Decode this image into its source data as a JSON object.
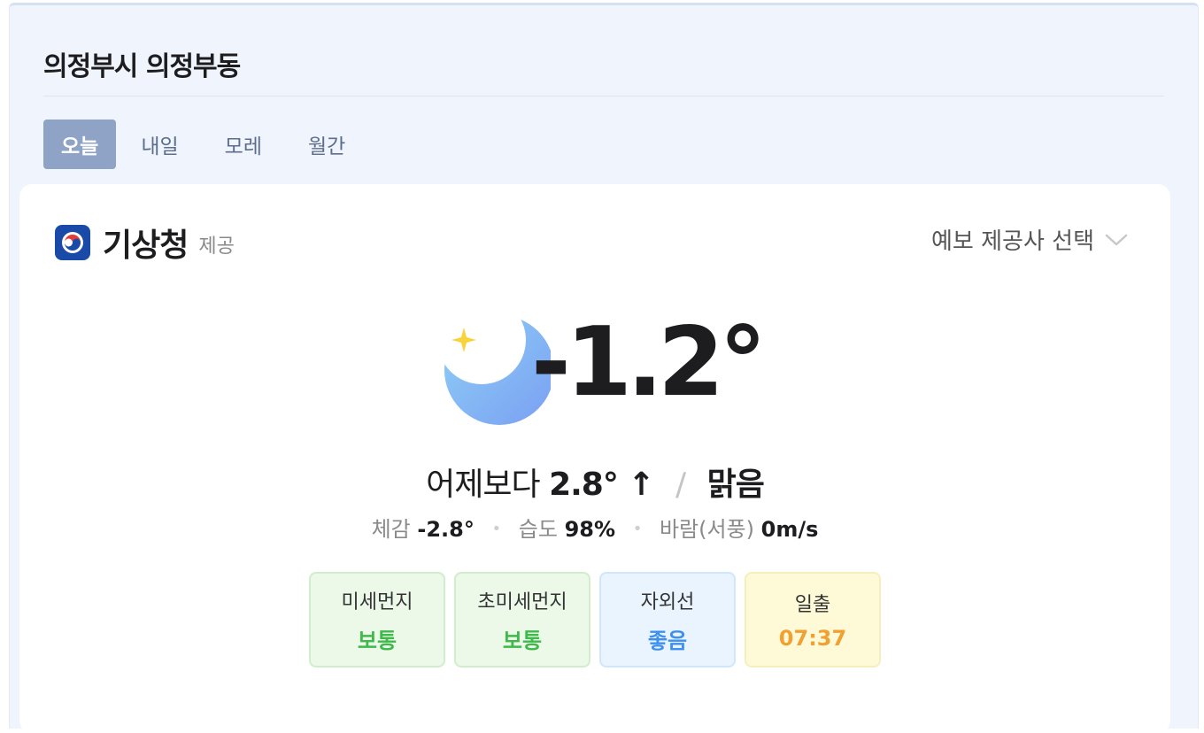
{
  "location": "의정부시 의정부동",
  "tabs": [
    {
      "label": "오늘",
      "active": true
    },
    {
      "label": "내일",
      "active": false
    },
    {
      "label": "모레",
      "active": false
    },
    {
      "label": "월간",
      "active": false
    }
  ],
  "provider": {
    "name": "기상청",
    "suffix": "제공"
  },
  "select_label": "예보 제공사 선택",
  "icons": {
    "logo": "kma-logo-icon",
    "weather": "crescent-moon-star-icon",
    "dropdown": "chevron-down-icon"
  },
  "current": {
    "temperature": "-1.2°",
    "compare_prefix": "어제보다",
    "compare_value": "2.8° ↑",
    "separator": "/",
    "condition": "맑음"
  },
  "details": [
    {
      "label": "체감",
      "value": "-2.8°"
    },
    {
      "label": "습도",
      "value": "98%"
    },
    {
      "label": "바람(서풍)",
      "value": "0m/s"
    }
  ],
  "detail_dot": "•",
  "tiles": [
    {
      "label": "미세먼지",
      "value": "보통",
      "tone": "green"
    },
    {
      "label": "초미세먼지",
      "value": "보통",
      "tone": "green"
    },
    {
      "label": "자외선",
      "value": "좋음",
      "tone": "blue"
    },
    {
      "label": "일출",
      "value": "07:37",
      "tone": "yellow"
    }
  ],
  "colors": {
    "panel_bg": "#eff4fd",
    "tab_active_bg": "#8ea3c6",
    "good_green": "#3fb94a",
    "good_blue": "#3d8ff0",
    "sunrise_orange": "#f0a132"
  }
}
